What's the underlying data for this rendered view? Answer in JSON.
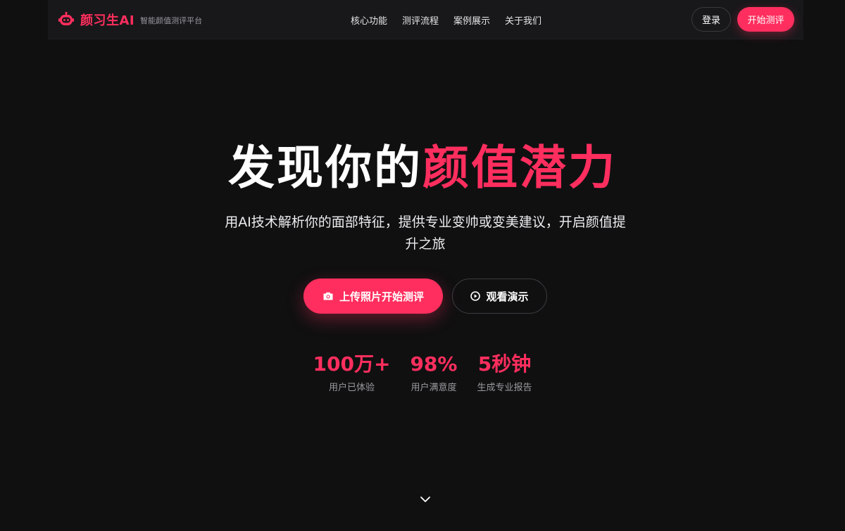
{
  "brand": {
    "name": "颜习生AI",
    "tagline": "智能颜值测评平台",
    "icon": "robot-icon"
  },
  "nav": {
    "links": [
      "核心功能",
      "测评流程",
      "案例展示",
      "关于我们"
    ],
    "login_label": "登录",
    "start_label": "开始测评"
  },
  "hero": {
    "title_white": "发现你的",
    "title_pink": "颜值潜力",
    "subtitle": "用AI技术解析你的面部特征，提供专业变帅或变美建议，开启颜值提升之旅",
    "upload_label": "上传照片开始测评",
    "upload_icon": "camera-icon",
    "demo_label": "观看演示",
    "demo_icon": "play-icon"
  },
  "stats": [
    {
      "value": "100万+",
      "label": "用户已体验"
    },
    {
      "value": "98%",
      "label": "用户满意度"
    },
    {
      "value": "5秒钟",
      "label": "生成专业报告"
    }
  ],
  "colors": {
    "accent": "#ff2e5e",
    "background": "#101011",
    "nav_background": "#18181a"
  },
  "scroll_icon": "chevron-down-icon"
}
